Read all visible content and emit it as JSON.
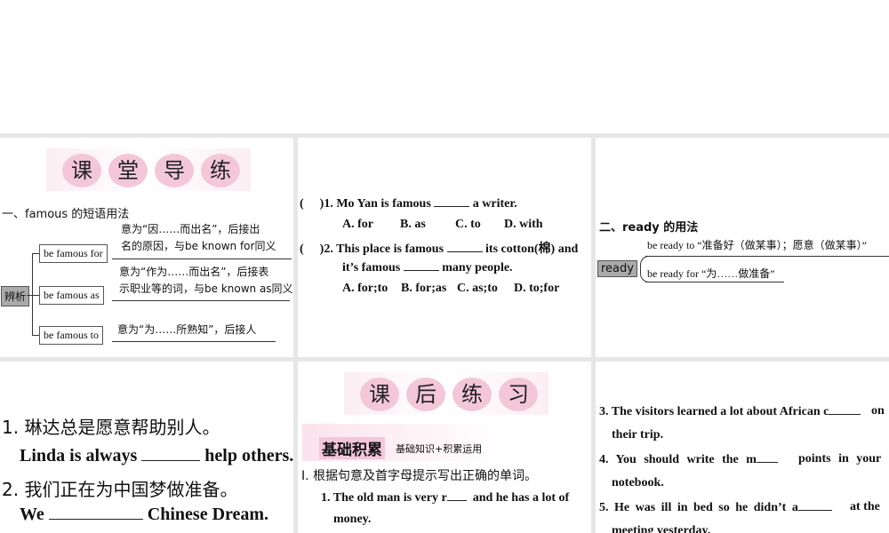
{
  "panel1": {
    "banner": [
      "课",
      "堂",
      "导",
      "练"
    ],
    "heading": "一、famous 的短语用法",
    "root": "辨析",
    "items": [
      {
        "phrase": "be famous for",
        "desc1": "意为“因……而出名”，后接出",
        "desc2": "名的原因，与be known for同义"
      },
      {
        "phrase": "be famous as",
        "desc1": "意为“作为……而出名”，后接表",
        "desc2": "示职业等的词，与be known as同义"
      },
      {
        "phrase": "be famous to",
        "desc1": "意为“为……所熟知”，后接人",
        "desc2": ""
      }
    ]
  },
  "panel2": {
    "q1": {
      "paren": "(",
      "text_a": ")1. Mo Yan is famous",
      "text_b": "a writer.",
      "options": [
        "A. for",
        "B. as",
        "C. to",
        "D. with"
      ]
    },
    "q2": {
      "paren": "(",
      "text_a": ")2. This place is famous",
      "text_b": "its cotton(棉) and",
      "line2_a": "it’s famous",
      "line2_b": "many people.",
      "options": [
        "A. for;to",
        "B. for;as",
        "C. as;to",
        "D. to;for"
      ]
    }
  },
  "panel3": {
    "heading": "二、ready 的用法",
    "root": "ready",
    "items": [
      "be ready to “准备好（做某事）；愿意（做某事）”",
      "be ready for “为……做准备”"
    ]
  },
  "panel4": {
    "s1": "1. 琳达总是愿意帮助别人。",
    "s1_en_a": "Linda is always",
    "s1_en_b": "help others.",
    "s2": "2. 我们正在为中国梦做准备。",
    "s2_en_a": "We",
    "s2_en_b": "Chinese Dream."
  },
  "panel5": {
    "banner": [
      "课",
      "后",
      "练",
      "习"
    ],
    "section": "基础积累",
    "section_sub": "基础知识+积累运用",
    "instruction": "Ⅰ. 根据句意及首字母提示写出正确的单词。",
    "q1_a": "1. The old man is very r",
    "q1_b": "and he has a lot of",
    "q1_c": "money."
  },
  "panel6": {
    "q3_a": "3. The visitors learned a lot about African c",
    "q3_b": "on",
    "q3_c": "their trip.",
    "q4_a": "4. You should write the m",
    "q4_b": "points in your",
    "q4_c": "notebook.",
    "q5_a": "5. He was ill in bed so he didn’t a",
    "q5_b": "at the",
    "q5_c": "meeting yesterday."
  }
}
